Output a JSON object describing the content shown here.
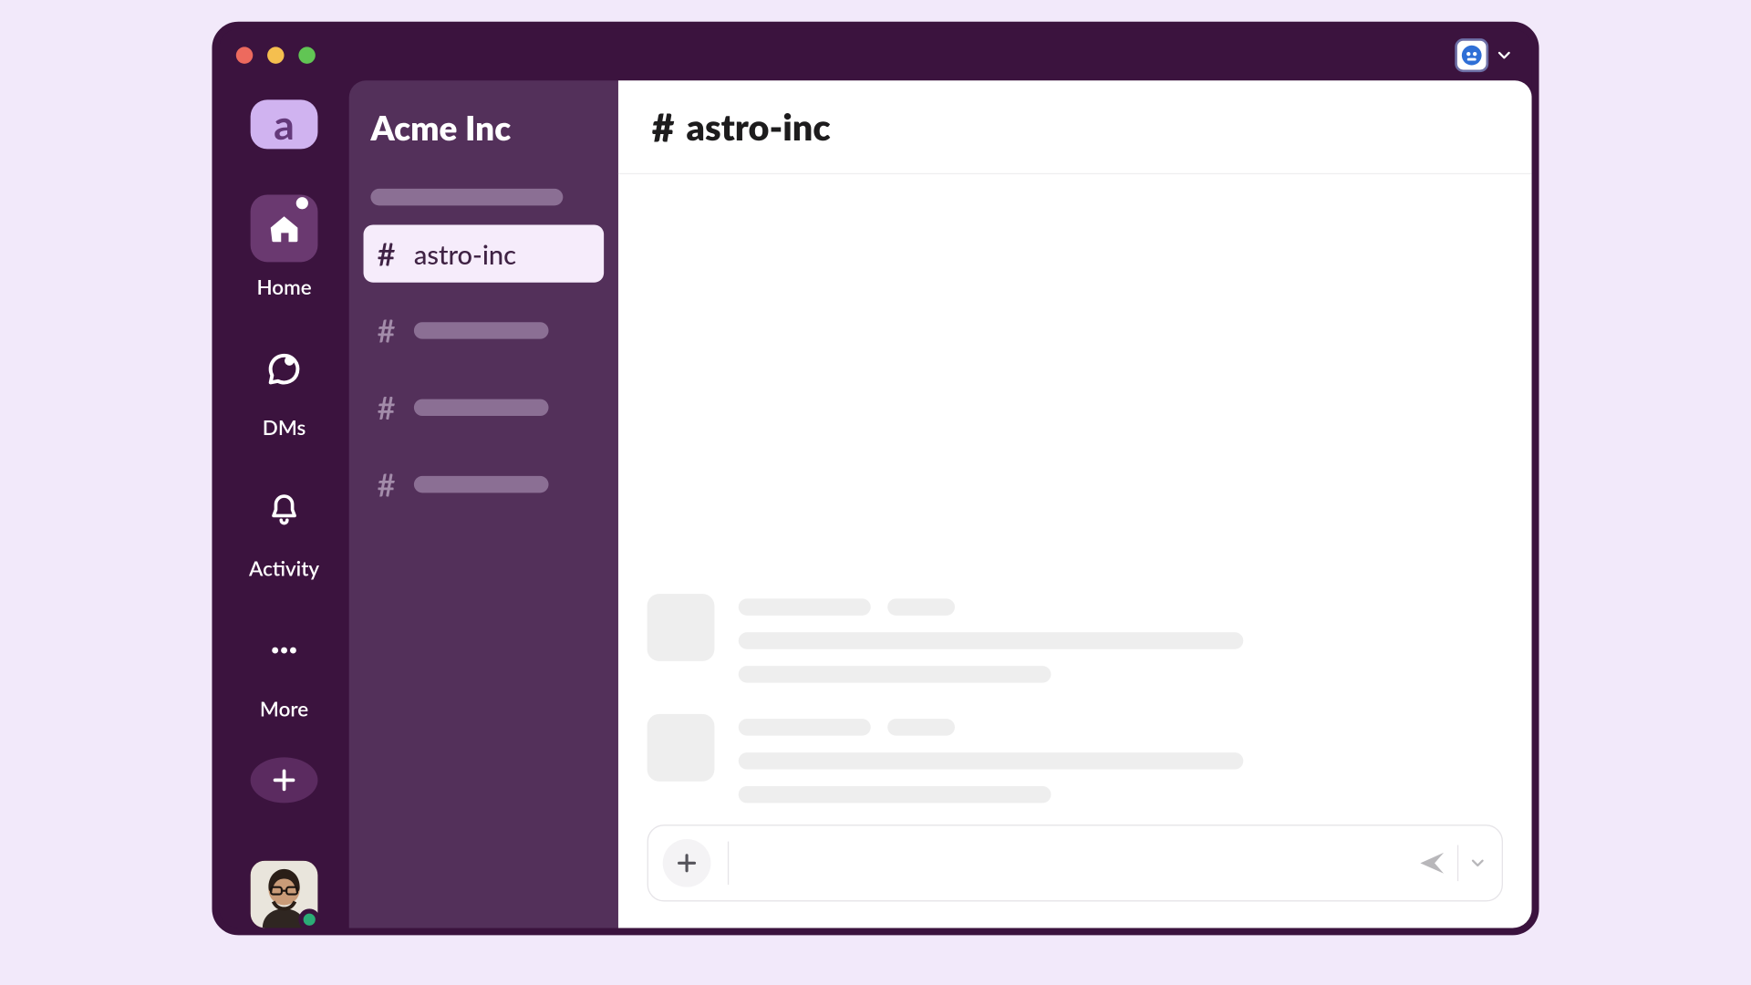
{
  "workspace": {
    "name": "Acme Inc",
    "tile_letter": "a"
  },
  "rail": {
    "home": {
      "label": "Home"
    },
    "dms": {
      "label": "DMs"
    },
    "activity": {
      "label": "Activity"
    },
    "more": {
      "label": "More"
    }
  },
  "sidebar": {
    "selected_channel": {
      "name": "astro-inc"
    }
  },
  "channel_header": {
    "name": "astro-inc"
  },
  "composer": {
    "placeholder": ""
  },
  "colors": {
    "app_shell": "#3b133e",
    "sidebar": "#53305a",
    "accent_selected": "#f6ecfb",
    "presence_online": "#2bac76"
  }
}
